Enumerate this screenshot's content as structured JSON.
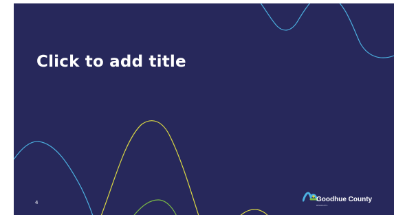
{
  "slide": {
    "title_placeholder": "Click to add title",
    "page_number": "4",
    "background_color": "#27285b",
    "wave_colors": {
      "cyan": "#4cb1e1",
      "yellow": "#dcd943",
      "green": "#7cbb46"
    }
  },
  "logo": {
    "name": "Goodhue County",
    "subtext": "MINNESOTA",
    "icon": "goodhue-county-logo-icon"
  }
}
